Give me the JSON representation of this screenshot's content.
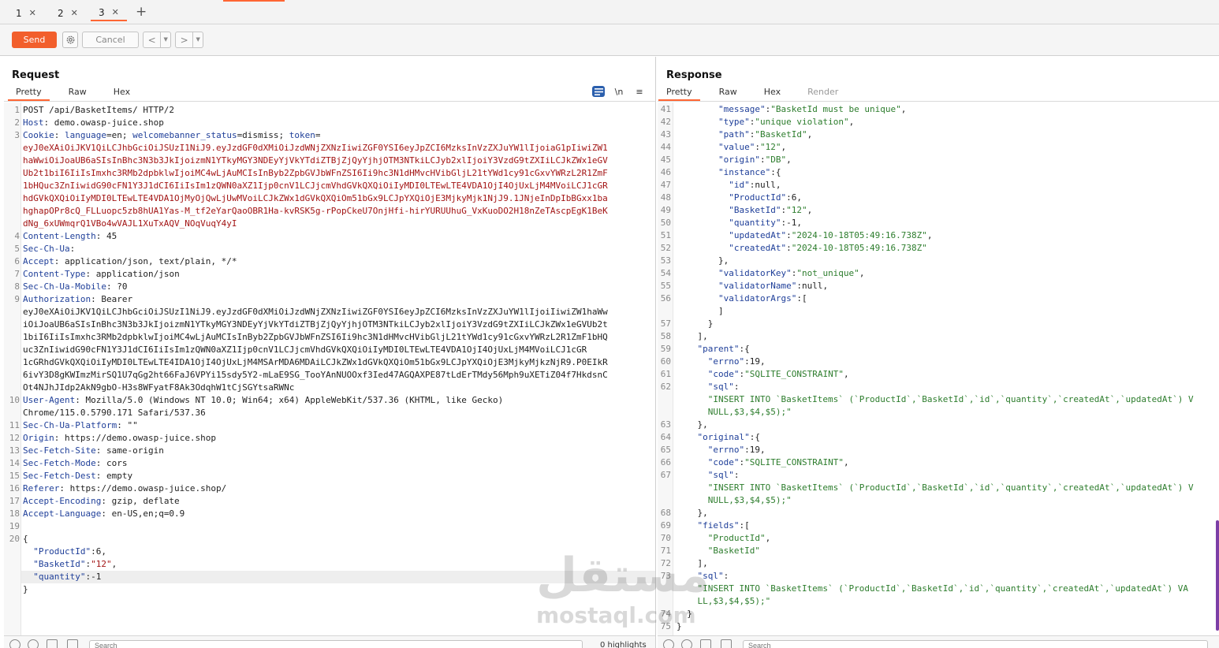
{
  "tabs": [
    {
      "label": "1",
      "active": false
    },
    {
      "label": "2",
      "active": false
    },
    {
      "label": "3",
      "active": true
    }
  ],
  "toolbar": {
    "send_label": "Send",
    "cancel_label": "Cancel",
    "back_label": "<",
    "forward_label": ">"
  },
  "request": {
    "title": "Request",
    "subtabs": [
      "Pretty",
      "Raw",
      "Hex"
    ],
    "lines": [
      {
        "n": "1",
        "parts": [
          [
            "v",
            "POST /api/BasketItems/ HTTP/2"
          ]
        ]
      },
      {
        "n": "2",
        "parts": [
          [
            "k",
            "Host"
          ],
          [
            "v",
            ": demo.owasp-juice.shop"
          ]
        ]
      },
      {
        "n": "3",
        "parts": [
          [
            "k",
            "Cookie"
          ],
          [
            "v",
            ": "
          ],
          [
            "k",
            "language"
          ],
          [
            "v",
            "=en; "
          ],
          [
            "k",
            "welcomebanner_status"
          ],
          [
            "v",
            "=dismiss; "
          ],
          [
            "k",
            "token"
          ],
          [
            "v",
            "="
          ]
        ]
      },
      {
        "n": "",
        "parts": [
          [
            "red",
            "eyJ0eXAiOiJKV1QiLCJhbGciOiJSUzI1NiJ9.eyJzdGF0dXMiOiJzdWNjZXNzIiwiZGF0YSI6eyJpZCI6MzksInVzZXJuYW1lIjoiaG1pIiwiZW1"
          ]
        ]
      },
      {
        "n": "",
        "parts": [
          [
            "red",
            "haWwiOiJoaUB6aSIsInBhc3N3b3JkIjoizmN1YTkyMGY3NDEyYjVkYTdiZTBjZjQyYjhjOTM3NTkiLCJyb2xlIjoiY3VzdG9tZXIiLCJkZWx1eGV"
          ]
        ]
      },
      {
        "n": "",
        "parts": [
          [
            "red",
            "Ub2t1biI6IiIsImxhc3RMb2dpbklwIjoiMC4wLjAuMCIsInByb2ZpbGVJbWFnZSI6Ii9hc3N1dHMvcHVibGljL21tYWd1cy91cGxvYWRzL2R1ZmF"
          ]
        ]
      },
      {
        "n": "",
        "parts": [
          [
            "red",
            "1bHQuc3ZnIiwidG90cFN1Y3J1dCI6IiIsIm1zQWN0aXZ1Ijp0cnV1LCJjcmVhdGVkQXQiOiIyMDI0LTEwLTE4VDA1OjI4OjUxLjM4MVoiLCJ1cGR"
          ]
        ]
      },
      {
        "n": "",
        "parts": [
          [
            "red",
            "hdGVkQXQiOiIyMDI0LTEwLTE4VDA1OjMyOjQwLjUwMVoiLCJkZWx1dGVkQXQiOm51bGx9LCJpYXQiOjE3MjkyMjk1NjJ9.1JNjeInDpIbBGxx1ba"
          ]
        ]
      },
      {
        "n": "",
        "parts": [
          [
            "red",
            "hghapOPr8cQ_FLLuopc5zb8hUA1Yas-M_tf2eYarQaoOBR1Ha-kvRSK5g-rPopCkeU7OnjHfi-hirYURUUhuG_VxKuoDO2H18nZeTAscpEgK1BeK"
          ]
        ]
      },
      {
        "n": "",
        "parts": [
          [
            "red",
            "dNg_6xUWmqrQ1VBo4wVAJL1XuTxAQV_NOqVuqY4yI"
          ]
        ]
      },
      {
        "n": "4",
        "parts": [
          [
            "k",
            "Content-Length"
          ],
          [
            "v",
            ": 45"
          ]
        ]
      },
      {
        "n": "5",
        "parts": [
          [
            "k",
            "Sec-Ch-Ua"
          ],
          [
            "v",
            ":"
          ]
        ]
      },
      {
        "n": "6",
        "parts": [
          [
            "k",
            "Accept"
          ],
          [
            "v",
            ": application/json, text/plain, */*"
          ]
        ]
      },
      {
        "n": "7",
        "parts": [
          [
            "k",
            "Content-Type"
          ],
          [
            "v",
            ": application/json"
          ]
        ]
      },
      {
        "n": "8",
        "parts": [
          [
            "k",
            "Sec-Ch-Ua-Mobile"
          ],
          [
            "v",
            ": ?0"
          ]
        ]
      },
      {
        "n": "9",
        "parts": [
          [
            "k",
            "Authorization"
          ],
          [
            "v",
            ": Bearer"
          ]
        ]
      },
      {
        "n": "",
        "parts": [
          [
            "v",
            "eyJ0eXAiOiJKV1QiLCJhbGciOiJSUzI1NiJ9.eyJzdGF0dXMiOiJzdWNjZXNzIiwiZGF0YSI6eyJpZCI6MzksInVzZXJuYW1lIjoiIiwiZW1haWw"
          ]
        ]
      },
      {
        "n": "",
        "parts": [
          [
            "v",
            "iOiJoaUB6aSIsInBhc3N3b3JkIjoizmN1YTkyMGY3NDEyYjVkYTdiZTBjZjQyYjhjOTM3NTkiLCJyb2xlIjoiY3VzdG9tZXIiLCJkZWx1eGVUb2t"
          ]
        ]
      },
      {
        "n": "",
        "parts": [
          [
            "v",
            "1biI6IiIsImxhc3RMb2dpbklwIjoiMC4wLjAuMCIsInByb2ZpbGVJbWFnZSI6Ii9hc3N1dHMvcHVibGljL21tYWd1cy91cGxvYWRzL2R1ZmF1bHQ"
          ]
        ]
      },
      {
        "n": "",
        "parts": [
          [
            "v",
            "uc3ZnIiwidG90cFN1Y3J1dCI6IiIsIm1zQWN0aXZ1Ijp0cnV1LCJjcmVhdGVkQXQiOiIyMDI0LTEwLTE4VDA1OjI4OjUxLjM4MVoiLCJ1cGR"
          ]
        ]
      },
      {
        "n": "",
        "parts": [
          [
            "v",
            "1cGRhdGVkQXQiOiIyMDI0LTEwLTE4IDA1OjI4OjUxLjM4MSArMDA6MDAiLCJkZWx1dGVkQXQiOm51bGx9LCJpYXQiOjE3MjkyMjkzNjR9.P0EIkR"
          ]
        ]
      },
      {
        "n": "",
        "parts": [
          [
            "v",
            "6ivY3D8gKWImzMirSQ1U7qGg2ht66FaJ6VPYi15sdy5Y2-mLaE9SG_TooYAnNUOOxf3Ied47AGQAXPE87tLdErTMdy56Mph9uXETiZ04f7HkdsnC"
          ]
        ]
      },
      {
        "n": "",
        "parts": [
          [
            "v",
            "Ot4NJhJIdp2AkN9gbO-H3s8WFyatF8Ak3OdqhW1tCjSGYtsaRWNc"
          ]
        ]
      },
      {
        "n": "10",
        "parts": [
          [
            "k",
            "User-Agent"
          ],
          [
            "v",
            ": Mozilla/5.0 (Windows NT 10.0; Win64; x64) AppleWebKit/537.36 (KHTML, like Gecko)"
          ]
        ]
      },
      {
        "n": "",
        "parts": [
          [
            "v",
            "Chrome/115.0.5790.171 Safari/537.36"
          ]
        ]
      },
      {
        "n": "11",
        "parts": [
          [
            "k",
            "Sec-Ch-Ua-Platform"
          ],
          [
            "v",
            ": \"\""
          ]
        ]
      },
      {
        "n": "12",
        "parts": [
          [
            "k",
            "Origin"
          ],
          [
            "v",
            ": https://demo.owasp-juice.shop"
          ]
        ]
      },
      {
        "n": "13",
        "parts": [
          [
            "k",
            "Sec-Fetch-Site"
          ],
          [
            "v",
            ": same-origin"
          ]
        ]
      },
      {
        "n": "14",
        "parts": [
          [
            "k",
            "Sec-Fetch-Mode"
          ],
          [
            "v",
            ": cors"
          ]
        ]
      },
      {
        "n": "15",
        "parts": [
          [
            "k",
            "Sec-Fetch-Dest"
          ],
          [
            "v",
            ": empty"
          ]
        ]
      },
      {
        "n": "16",
        "parts": [
          [
            "k",
            "Referer"
          ],
          [
            "v",
            ": https://demo.owasp-juice.shop/"
          ]
        ]
      },
      {
        "n": "17",
        "parts": [
          [
            "k",
            "Accept-Encoding"
          ],
          [
            "v",
            ": gzip, deflate"
          ]
        ]
      },
      {
        "n": "18",
        "parts": [
          [
            "k",
            "Accept-Language"
          ],
          [
            "v",
            ": en-US,en;q=0.9"
          ]
        ]
      },
      {
        "n": "19",
        "parts": []
      },
      {
        "n": "20",
        "parts": [
          [
            "v",
            "{"
          ]
        ]
      },
      {
        "n": "",
        "parts": [
          [
            "v",
            "  "
          ],
          [
            "k",
            "\"ProductId\""
          ],
          [
            "v",
            ":6,"
          ]
        ]
      },
      {
        "n": "",
        "parts": [
          [
            "v",
            "  "
          ],
          [
            "k",
            "\"BasketId\""
          ],
          [
            "v",
            ":"
          ],
          [
            "red",
            "\"12\""
          ],
          [
            "v",
            ","
          ]
        ]
      },
      {
        "n": "",
        "parts": [
          [
            "v",
            "  "
          ],
          [
            "k",
            "\"quantity\""
          ],
          [
            "v",
            ":-1"
          ]
        ]
      },
      {
        "n": "",
        "parts": [
          [
            "v",
            "}"
          ]
        ]
      }
    ],
    "search_placeholder": "Search",
    "highlights": "0 highlights"
  },
  "response": {
    "title": "Response",
    "subtabs": [
      "Pretty",
      "Raw",
      "Hex",
      "Render"
    ],
    "lines": [
      {
        "n": "41",
        "parts": [
          [
            "v",
            "        "
          ],
          [
            "k",
            "\"message\""
          ],
          [
            "v",
            ":"
          ],
          [
            "str",
            "\"BasketId must be unique\""
          ],
          [
            "v",
            ","
          ]
        ]
      },
      {
        "n": "42",
        "parts": [
          [
            "v",
            "        "
          ],
          [
            "k",
            "\"type\""
          ],
          [
            "v",
            ":"
          ],
          [
            "str",
            "\"unique violation\""
          ],
          [
            "v",
            ","
          ]
        ]
      },
      {
        "n": "43",
        "parts": [
          [
            "v",
            "        "
          ],
          [
            "k",
            "\"path\""
          ],
          [
            "v",
            ":"
          ],
          [
            "str",
            "\"BasketId\""
          ],
          [
            "v",
            ","
          ]
        ]
      },
      {
        "n": "44",
        "parts": [
          [
            "v",
            "        "
          ],
          [
            "k",
            "\"value\""
          ],
          [
            "v",
            ":"
          ],
          [
            "str",
            "\"12\""
          ],
          [
            "v",
            ","
          ]
        ]
      },
      {
        "n": "45",
        "parts": [
          [
            "v",
            "        "
          ],
          [
            "k",
            "\"origin\""
          ],
          [
            "v",
            ":"
          ],
          [
            "str",
            "\"DB\""
          ],
          [
            "v",
            ","
          ]
        ]
      },
      {
        "n": "46",
        "parts": [
          [
            "v",
            "        "
          ],
          [
            "k",
            "\"instance\""
          ],
          [
            "v",
            ":{"
          ]
        ]
      },
      {
        "n": "47",
        "parts": [
          [
            "v",
            "          "
          ],
          [
            "k",
            "\"id\""
          ],
          [
            "v",
            ":null,"
          ]
        ]
      },
      {
        "n": "48",
        "parts": [
          [
            "v",
            "          "
          ],
          [
            "k",
            "\"ProductId\""
          ],
          [
            "v",
            ":6,"
          ]
        ]
      },
      {
        "n": "49",
        "parts": [
          [
            "v",
            "          "
          ],
          [
            "k",
            "\"BasketId\""
          ],
          [
            "v",
            ":"
          ],
          [
            "str",
            "\"12\""
          ],
          [
            "v",
            ","
          ]
        ]
      },
      {
        "n": "50",
        "parts": [
          [
            "v",
            "          "
          ],
          [
            "k",
            "\"quantity\""
          ],
          [
            "v",
            ":-1,"
          ]
        ]
      },
      {
        "n": "51",
        "parts": [
          [
            "v",
            "          "
          ],
          [
            "k",
            "\"updatedAt\""
          ],
          [
            "v",
            ":"
          ],
          [
            "str",
            "\"2024-10-18T05:49:16.738Z\""
          ],
          [
            "v",
            ","
          ]
        ]
      },
      {
        "n": "52",
        "parts": [
          [
            "v",
            "          "
          ],
          [
            "k",
            "\"createdAt\""
          ],
          [
            "v",
            ":"
          ],
          [
            "str",
            "\"2024-10-18T05:49:16.738Z\""
          ]
        ]
      },
      {
        "n": "53",
        "parts": [
          [
            "v",
            "        },"
          ]
        ]
      },
      {
        "n": "54",
        "parts": [
          [
            "v",
            "        "
          ],
          [
            "k",
            "\"validatorKey\""
          ],
          [
            "v",
            ":"
          ],
          [
            "str",
            "\"not_unique\""
          ],
          [
            "v",
            ","
          ]
        ]
      },
      {
        "n": "55",
        "parts": [
          [
            "v",
            "        "
          ],
          [
            "k",
            "\"validatorName\""
          ],
          [
            "v",
            ":null,"
          ]
        ]
      },
      {
        "n": "56",
        "parts": [
          [
            "v",
            "        "
          ],
          [
            "k",
            "\"validatorArgs\""
          ],
          [
            "v",
            ":["
          ]
        ]
      },
      {
        "n": "",
        "parts": [
          [
            "v",
            "        ]"
          ]
        ]
      },
      {
        "n": "57",
        "parts": [
          [
            "v",
            "      }"
          ]
        ]
      },
      {
        "n": "58",
        "parts": [
          [
            "v",
            "    ],"
          ]
        ]
      },
      {
        "n": "59",
        "parts": [
          [
            "v",
            "    "
          ],
          [
            "k",
            "\"parent\""
          ],
          [
            "v",
            ":{"
          ]
        ]
      },
      {
        "n": "60",
        "parts": [
          [
            "v",
            "      "
          ],
          [
            "k",
            "\"errno\""
          ],
          [
            "v",
            ":19,"
          ]
        ]
      },
      {
        "n": "61",
        "parts": [
          [
            "v",
            "      "
          ],
          [
            "k",
            "\"code\""
          ],
          [
            "v",
            ":"
          ],
          [
            "str",
            "\"SQLITE_CONSTRAINT\""
          ],
          [
            "v",
            ","
          ]
        ]
      },
      {
        "n": "62",
        "parts": [
          [
            "v",
            "      "
          ],
          [
            "k",
            "\"sql\""
          ],
          [
            "v",
            ":"
          ]
        ]
      },
      {
        "n": "",
        "parts": [
          [
            "str",
            "      \"INSERT INTO `BasketItems` (`ProductId`,`BasketId`,`id`,`quantity`,`createdAt`,`updatedAt`) V"
          ]
        ]
      },
      {
        "n": "",
        "parts": [
          [
            "str",
            "      NULL,$3,$4,$5);\""
          ]
        ]
      },
      {
        "n": "63",
        "parts": [
          [
            "v",
            "    },"
          ]
        ]
      },
      {
        "n": "64",
        "parts": [
          [
            "v",
            "    "
          ],
          [
            "k",
            "\"original\""
          ],
          [
            "v",
            ":{"
          ]
        ]
      },
      {
        "n": "65",
        "parts": [
          [
            "v",
            "      "
          ],
          [
            "k",
            "\"errno\""
          ],
          [
            "v",
            ":19,"
          ]
        ]
      },
      {
        "n": "66",
        "parts": [
          [
            "v",
            "      "
          ],
          [
            "k",
            "\"code\""
          ],
          [
            "v",
            ":"
          ],
          [
            "str",
            "\"SQLITE_CONSTRAINT\""
          ],
          [
            "v",
            ","
          ]
        ]
      },
      {
        "n": "67",
        "parts": [
          [
            "v",
            "      "
          ],
          [
            "k",
            "\"sql\""
          ],
          [
            "v",
            ":"
          ]
        ]
      },
      {
        "n": "",
        "parts": [
          [
            "str",
            "      \"INSERT INTO `BasketItems` (`ProductId`,`BasketId`,`id`,`quantity`,`createdAt`,`updatedAt`) V"
          ]
        ]
      },
      {
        "n": "",
        "parts": [
          [
            "str",
            "      NULL,$3,$4,$5);\""
          ]
        ]
      },
      {
        "n": "68",
        "parts": [
          [
            "v",
            "    },"
          ]
        ]
      },
      {
        "n": "69",
        "parts": [
          [
            "v",
            "    "
          ],
          [
            "k",
            "\"fields\""
          ],
          [
            "v",
            ":["
          ]
        ]
      },
      {
        "n": "70",
        "parts": [
          [
            "str",
            "      \"ProductId\""
          ],
          [
            "v",
            ","
          ]
        ]
      },
      {
        "n": "71",
        "parts": [
          [
            "str",
            "      \"BasketId\""
          ]
        ]
      },
      {
        "n": "72",
        "parts": [
          [
            "v",
            "    ],"
          ]
        ]
      },
      {
        "n": "73",
        "parts": [
          [
            "v",
            "    "
          ],
          [
            "k",
            "\"sql\""
          ],
          [
            "v",
            ":"
          ]
        ]
      },
      {
        "n": "",
        "parts": [
          [
            "str",
            "    \"INSERT INTO `BasketItems` (`ProductId`,`BasketId`,`id`,`quantity`,`createdAt`,`updatedAt`) VA"
          ]
        ]
      },
      {
        "n": "",
        "parts": [
          [
            "str",
            "    LL,$3,$4,$5);\""
          ]
        ]
      },
      {
        "n": "74",
        "parts": [
          [
            "v",
            "  }"
          ]
        ]
      },
      {
        "n": "75",
        "parts": [
          [
            "v",
            "}"
          ]
        ]
      }
    ],
    "search_placeholder": "Search"
  },
  "watermark": {
    "arabic": "مستقل",
    "latin": "mostaql.com"
  },
  "colors": {
    "accent": "#ff6633",
    "send": "#f25f2c",
    "key": "#1f3f99",
    "token": "#a31515",
    "string": "#2d7d2d"
  }
}
